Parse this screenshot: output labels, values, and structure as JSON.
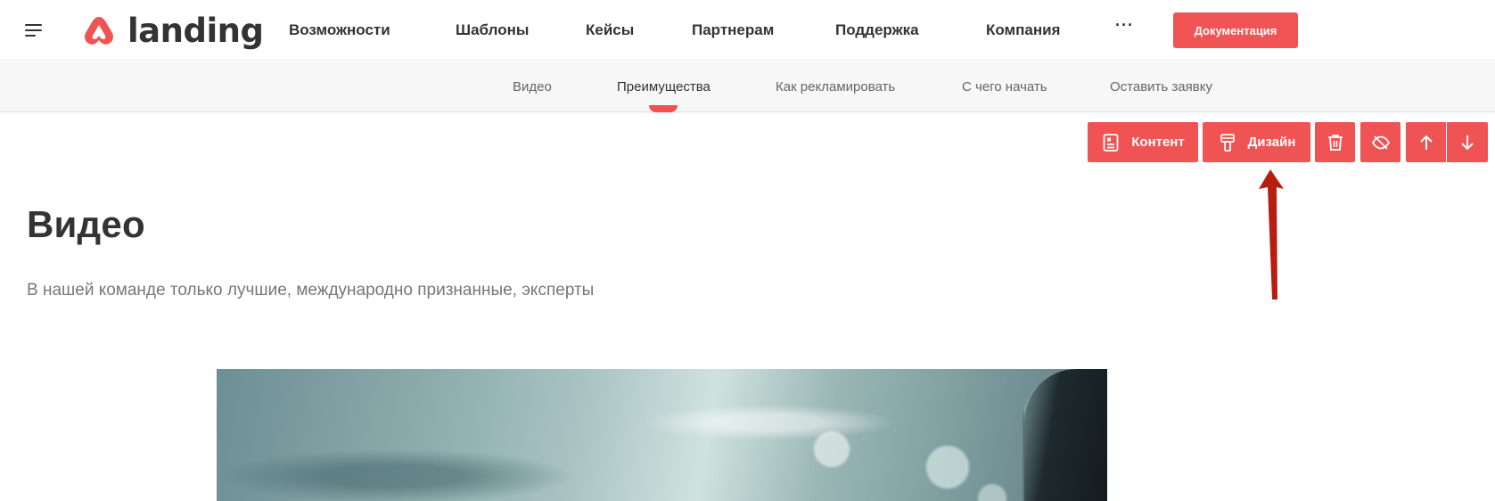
{
  "header": {
    "logo_text": "landing",
    "nav": [
      {
        "label": "Возможности"
      },
      {
        "label": "Шаблоны"
      },
      {
        "label": "Кейсы"
      },
      {
        "label": "Партнерам"
      },
      {
        "label": "Поддержка"
      },
      {
        "label": "Компания"
      }
    ],
    "more_label": "···",
    "docs_label": "Документация"
  },
  "subnav": {
    "items": [
      {
        "label": "Видео"
      },
      {
        "label": "Преимущества",
        "active": true
      },
      {
        "label": "Как рекламировать"
      },
      {
        "label": "С чего начать"
      },
      {
        "label": "Оставить заявку"
      }
    ]
  },
  "block_toolbar": {
    "content_label": "Контент",
    "design_label": "Дизайн",
    "icons": [
      "content-icon",
      "paint-roller-icon",
      "trash-icon",
      "eye-off-icon",
      "arrow-up-icon",
      "arrow-down-icon"
    ]
  },
  "section": {
    "title": "Видео",
    "subtitle": "В нашей команде только лучшие, международно признанные, эксперты"
  },
  "colors": {
    "accent": "#ef5353",
    "annotation_arrow": "#b81e10",
    "text_dark": "#333333",
    "text_muted": "#777777",
    "subnav_bg": "#f7f7f7"
  }
}
